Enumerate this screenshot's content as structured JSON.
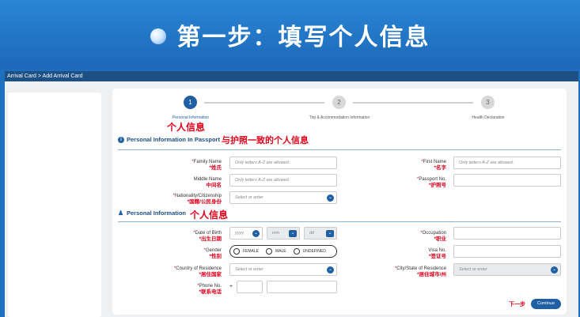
{
  "banner": {
    "title": "第一步：填写个人信息"
  },
  "breadcrumb": "Arrival Card > Add Arrival Card",
  "steps": [
    {
      "num": "1",
      "label": "Personal Information",
      "zh": "个人信息"
    },
    {
      "num": "2",
      "label": "Trip & Accommodation Information"
    },
    {
      "num": "3",
      "label": "Health Declaration"
    }
  ],
  "passport_section": {
    "title": "Personal Information In Passport",
    "zh": "与护照一致的个人信息"
  },
  "personal_section": {
    "title": "Personal Information",
    "zh": "个人信息"
  },
  "fields": {
    "family_name": {
      "label": "Family Name",
      "zh": "*姓氏",
      "placeholder": "Only letters A-Z are allowed."
    },
    "first_name": {
      "label": "First Name",
      "zh": "*名字",
      "placeholder": "Only letters A-Z are allowed."
    },
    "middle_name": {
      "label": "Middle Name",
      "zh": "中间名",
      "placeholder": "Only letters A-Z are allowed."
    },
    "passport_no": {
      "label": "Passport No.",
      "zh": "*护照号",
      "placeholder": ""
    },
    "nationality": {
      "label": "Nationality/Citizenship",
      "zh": "*国籍/公民身份",
      "placeholder": "Select or enter"
    },
    "dob": {
      "label": "Date of Birth",
      "zh": "*出生日期",
      "yyyy": "yyyy",
      "mm": "mm",
      "dd": "dd"
    },
    "occupation": {
      "label": "Occupation",
      "zh": "*职业"
    },
    "gender": {
      "label": "Gender",
      "zh": "*性别",
      "options": [
        "FEMALE",
        "MALE",
        "UNDEFINED"
      ]
    },
    "visa_no": {
      "label": "Visa No.",
      "zh": "*签证号"
    },
    "country_residence": {
      "label": "Country of Residence",
      "zh": "*居住国家",
      "placeholder": "Select or enter"
    },
    "city_residence": {
      "label": "City/State of Residence",
      "zh": "*居住城市/州",
      "placeholder": "Select or enter"
    },
    "phone": {
      "label": "Phone No.",
      "zh": "*联系电话",
      "plus": "+"
    }
  },
  "footer": {
    "next_zh": "下一步",
    "continue_label": "Continue"
  },
  "colors": {
    "brand": "#1f5fa3",
    "banner": "#2a86d6",
    "annotation": "#e0001a"
  },
  "icons": {
    "info": "info-icon",
    "person": "person-icon",
    "dropdown": "chevron-down-icon"
  }
}
